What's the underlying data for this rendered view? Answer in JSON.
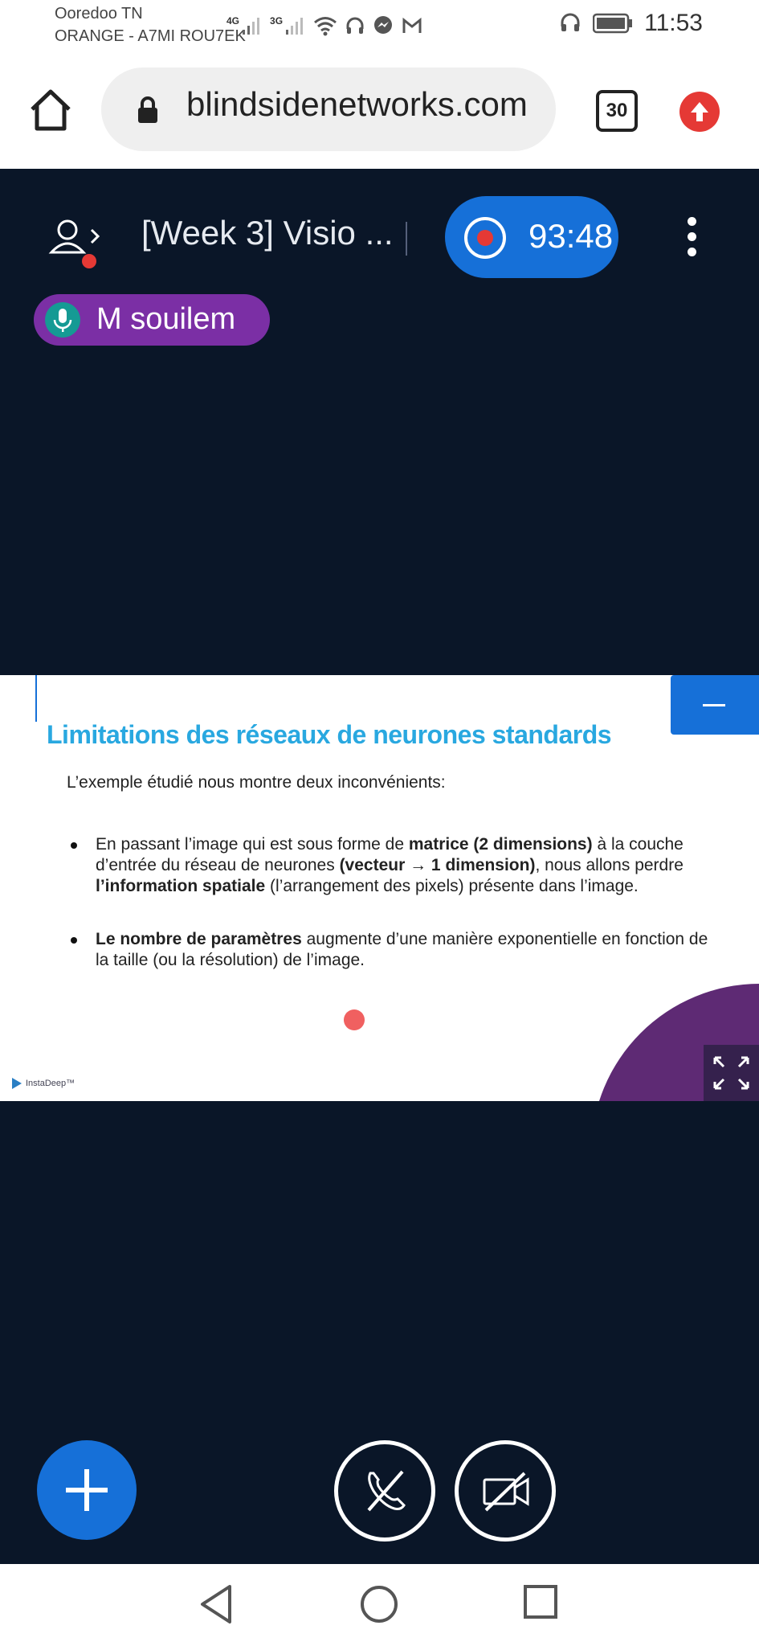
{
  "status_bar": {
    "carrier_1": "Ooredoo TN",
    "carrier_2": "ORANGE - A7MI ROU7EK",
    "network_1": "4G",
    "network_2": "3G",
    "time": "11:53"
  },
  "browser": {
    "url": "blindsidenetworks.com",
    "tab_count": "30"
  },
  "meeting": {
    "title": "[Week 3] Visio ...",
    "recording_time": "93:48",
    "talker_name": "M souilem"
  },
  "slide": {
    "title": "Limitations des réseaux de neurones standards",
    "intro": "L’exemple étudié nous montre deux inconvénients:",
    "bullet_1": {
      "t1": "En passant l’image qui est sous forme de ",
      "b1": "matrice (2 dimensions)",
      "t2": " à la couche d’entrée du réseau de neurones ",
      "b2": "(vecteur → 1 dimension)",
      "t3": ", nous allons perdre ",
      "b3": "l’information spatiale",
      "t4": " (l’arrangement des pixels) présente dans l’image."
    },
    "bullet_2": {
      "b1": "Le nombre de paramètres",
      "t1": " augmente d’une manière exponentielle en fonction de la taille (ou la résolution) de l’image."
    },
    "logo_text": "InstaDeep™"
  },
  "colors": {
    "accent": "#1670d8",
    "background": "#0a1628",
    "talker": "#7b2fa5",
    "title": "#29a8e0"
  }
}
